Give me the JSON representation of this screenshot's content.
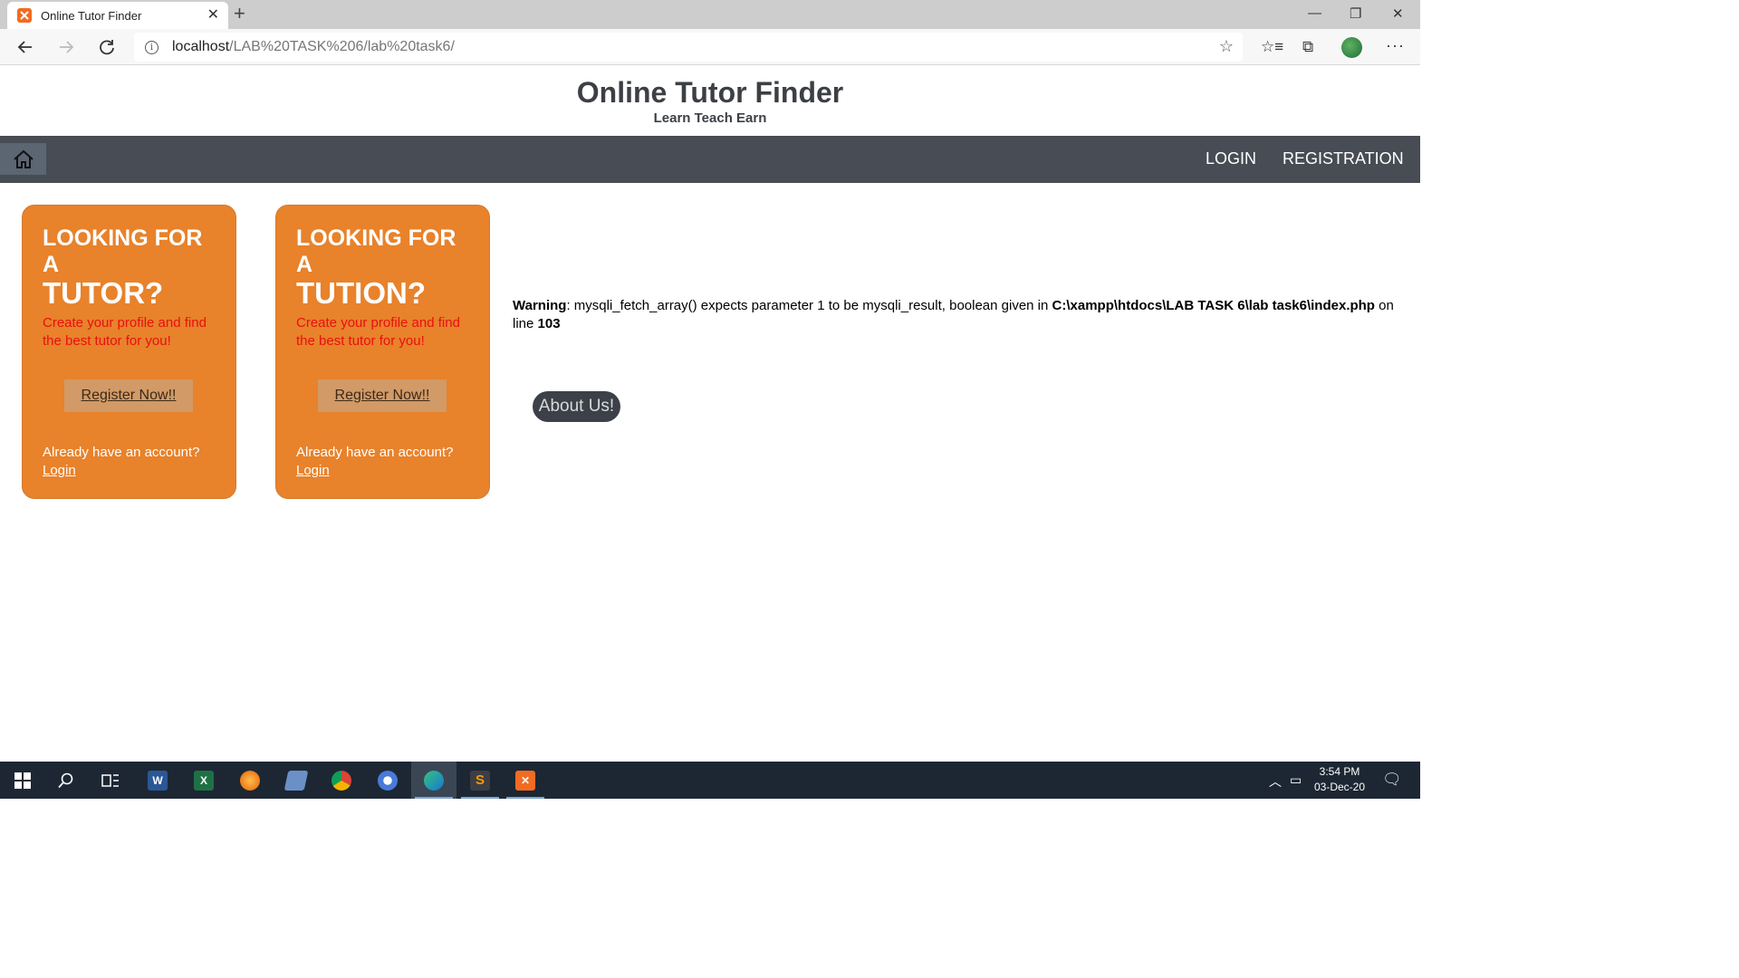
{
  "browser": {
    "tab_title": "Online Tutor Finder",
    "url_host": "localhost",
    "url_path": "/LAB%20TASK%206/lab%20task6/"
  },
  "header": {
    "title": "Online Tutor Finder",
    "tagline": "Learn Teach Earn"
  },
  "navbar": {
    "login": "LOGIN",
    "registration": "REGISTRATION"
  },
  "cards": [
    {
      "heading_line1": "LOOKING FOR A",
      "heading_line2": "TUTOR?",
      "description": "Create your profile and find the best tutor for you!",
      "button": "Register Now!!",
      "account_text": "Already have an account?",
      "login_link": "Login"
    },
    {
      "heading_line1": "LOOKING FOR A",
      "heading_line2": "TUTION?",
      "description": "Create your profile and find the best tutor for you!",
      "button": "Register Now!!",
      "account_text": "Already have an account?",
      "login_link": "Login"
    }
  ],
  "warning": {
    "label": "Warning",
    "message": ": mysqli_fetch_array() expects parameter 1 to be mysqli_result, boolean given in ",
    "file": "C:\\xampp\\htdocs\\LAB TASK 6\\lab task6\\index.php",
    "on_line": " on line ",
    "line": "103"
  },
  "about_button": "About Us!",
  "taskbar": {
    "time": "3:54 PM",
    "date": "03-Dec-20"
  },
  "colors": {
    "card_orange": "#e8822b",
    "navbar": "#474c55",
    "description_red": "#e91010"
  }
}
